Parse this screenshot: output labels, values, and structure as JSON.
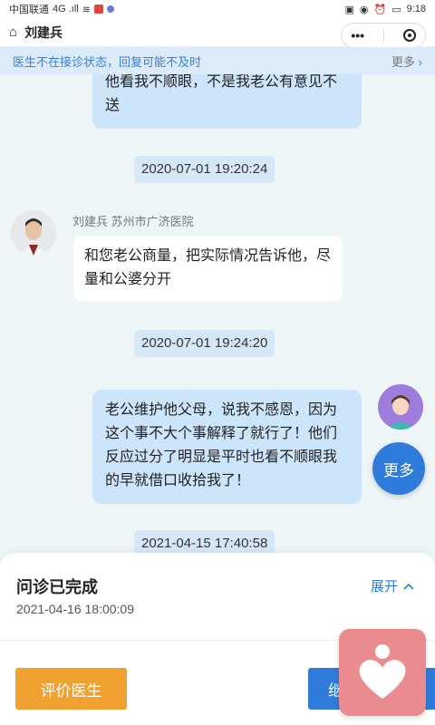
{
  "statusbar": {
    "carrier": "中国联通",
    "signal": "4G .ıll",
    "time": "9:18",
    "battery_icon": "battery-icon"
  },
  "titlebar": {
    "title": "刘建兵",
    "home_icon": "home-icon",
    "menu_label": "•••"
  },
  "notice": {
    "text": "医生不在接诊状态，回复可能不及时",
    "more": "更多"
  },
  "messages": {
    "m1": {
      "text": "他看我不顺眼，不是我老公有意见不送"
    },
    "t1": "2020-07-01 19:20:24",
    "doctor_name": "刘建兵 苏州市广济医院",
    "m2": {
      "text": "和您老公商量，把实际情况告诉他，尽量和公婆分开"
    },
    "t2": "2020-07-01 19:24:20",
    "m3": {
      "text": "老公维护他父母，说我不感恩，因为这个事不大个事解释了就行了！他们反应过分了明显是平时也看不顺眼我的早就借口收拾我了！"
    },
    "t3": "2021-04-15 17:40:58"
  },
  "fab": {
    "more": "更多"
  },
  "panel": {
    "status": "问诊已完成",
    "date": "2021-04-16 18:00:09",
    "expand": "展开",
    "rate_button": "评价医生",
    "continue_button": "继"
  },
  "colors": {
    "accent": "#2f7bdc",
    "orange": "#f0a12f",
    "my_bubble": "#cde5fb",
    "heart_bg": "#ea8c8f"
  }
}
